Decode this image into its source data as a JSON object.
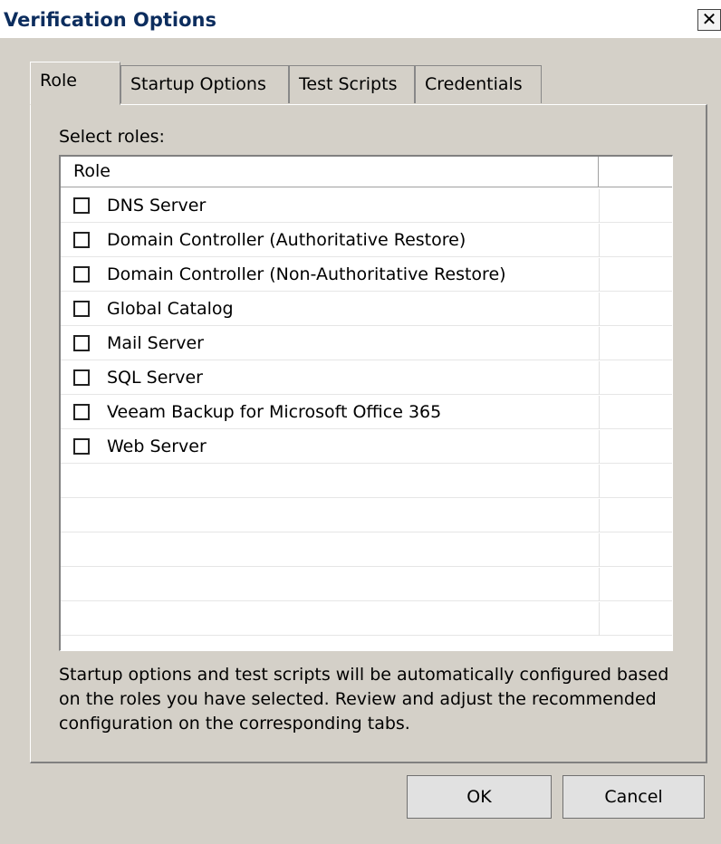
{
  "window": {
    "title": "Verification Options",
    "close_symbol": "✕"
  },
  "tabs": [
    {
      "label": "Role",
      "active": true
    },
    {
      "label": "Startup Options",
      "active": false
    },
    {
      "label": "Test Scripts",
      "active": false
    },
    {
      "label": "Credentials",
      "active": false
    }
  ],
  "role_tab": {
    "select_label": "Select roles:",
    "column_header": "Role",
    "roles": [
      {
        "label": "DNS Server",
        "checked": false
      },
      {
        "label": "Domain Controller (Authoritative Restore)",
        "checked": false
      },
      {
        "label": "Domain Controller (Non-Authoritative Restore)",
        "checked": false
      },
      {
        "label": "Global Catalog",
        "checked": false
      },
      {
        "label": "Mail Server",
        "checked": false
      },
      {
        "label": "SQL Server",
        "checked": false
      },
      {
        "label": "Veeam Backup for Microsoft Office 365",
        "checked": false
      },
      {
        "label": "Web Server",
        "checked": false
      }
    ],
    "info_text": "Startup options and test scripts will be automatically configured based on the roles you have selected. Review and adjust the recommended configuration on the corresponding tabs."
  },
  "buttons": {
    "ok": "OK",
    "cancel": "Cancel"
  }
}
